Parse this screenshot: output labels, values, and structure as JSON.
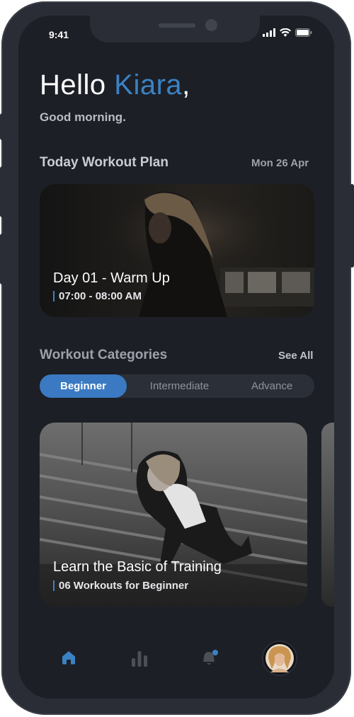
{
  "status_bar": {
    "time": "9:41"
  },
  "greeting": {
    "hello": "Hello ",
    "name": "Kiara",
    "comma": ",",
    "subtitle": "Good morning."
  },
  "today_plan": {
    "title": "Today Workout Plan",
    "date": "Mon 26 Apr",
    "card": {
      "title": "Day 01 - Warm Up",
      "time": "07:00 - 08:00 AM"
    }
  },
  "categories": {
    "title": "Workout Categories",
    "see_all": "See All",
    "tabs": [
      {
        "label": "Beginner",
        "active": true
      },
      {
        "label": "Intermediate",
        "active": false
      },
      {
        "label": "Advance",
        "active": false
      }
    ],
    "card": {
      "title": "Learn the Basic of Training",
      "subtitle": "06 Workouts  for Beginner"
    }
  },
  "bottom_nav": {
    "items": [
      {
        "icon": "home-icon",
        "active": true
      },
      {
        "icon": "bar-chart-icon",
        "active": false
      },
      {
        "icon": "notification-bell-icon",
        "active": false
      },
      {
        "icon": "profile-avatar",
        "active": false
      }
    ]
  },
  "colors": {
    "accent": "#3b82c4",
    "background": "#1c1f26",
    "surface": "#2b2f37"
  }
}
